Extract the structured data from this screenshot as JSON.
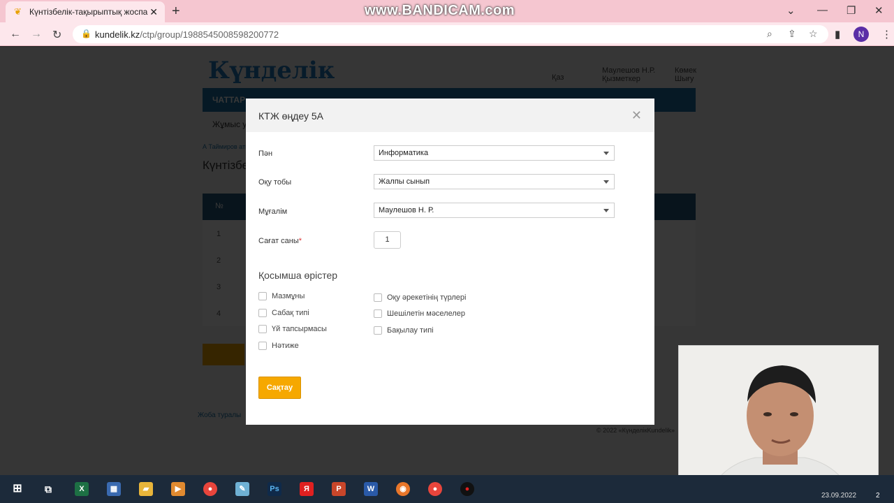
{
  "browser": {
    "tab_title": "Күнтізбелік-тақырыптық жоспа",
    "url_host": "kundelik.kz",
    "url_path": "/ctp/group/1988545008598200772",
    "profile_initial": "N",
    "watermark": "www.BANDICAM.com"
  },
  "site": {
    "logo": "Күнделік",
    "nav_first": "ЧАТТАР",
    "sub_link": "Жұмыс ус",
    "breadcrumb": "А Таймиров атындағы",
    "page_heading": "Күнтізбел",
    "lang": "Қаз",
    "user_name": "Маулешов Н.Р.",
    "user_role": "Қызметкер",
    "help": "Көмек",
    "exit": "Шығу",
    "footer_link": "Жоба туралы",
    "copyright": "© 2022 «КүнделікKundelik»",
    "rows": [
      "1",
      "2",
      "3",
      "4"
    ],
    "col_no": "№"
  },
  "modal": {
    "title": "КТЖ өңдеу 5А",
    "subject_label": "Пән",
    "subject_value": "Информатика",
    "group_label": "Оқу тобы",
    "group_value": "Жалпы сынып",
    "teacher_label": "Мұғалім",
    "teacher_value": "Маулешов Н. Р.",
    "hours_label": "Сағат саны",
    "hours_value": "1",
    "extra_section": "Қосымша өрістер",
    "checkboxes_left": [
      "Мазмұны",
      "Сабақ типі",
      "Үй тапсырмасы",
      "Нәтиже"
    ],
    "checkboxes_right": [
      "Оқу әрекетінің түрлері",
      "Шешілетін мәселелер",
      "Бақылау типі"
    ],
    "save_label": "Сақтау"
  },
  "taskbar": {
    "date": "23.09.2022",
    "notifications": "2"
  }
}
